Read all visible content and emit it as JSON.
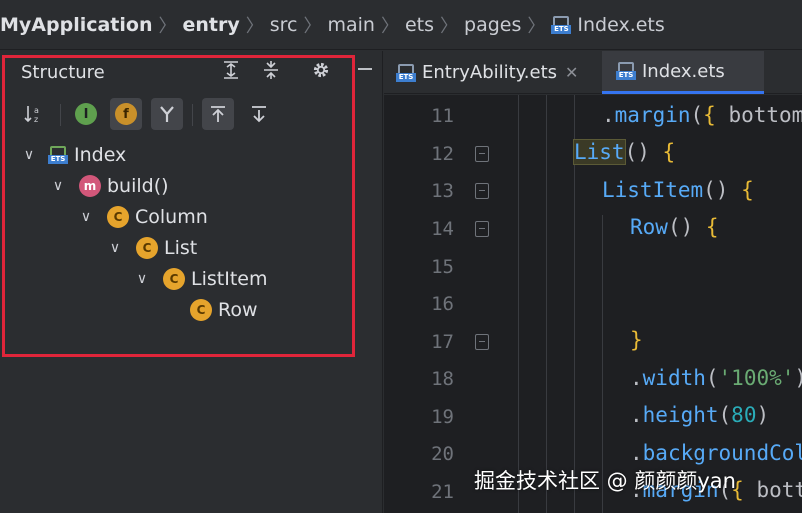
{
  "breadcrumb": {
    "items": [
      "MyApplication",
      "entry",
      "src",
      "main",
      "ets",
      "pages"
    ],
    "file": "Index.ets"
  },
  "structure": {
    "title": "Structure",
    "tree": [
      {
        "label": "Index",
        "kind": "file",
        "depth": 0,
        "expanded": true
      },
      {
        "label": "build()",
        "kind": "method",
        "badge": "m",
        "depth": 1,
        "expanded": true
      },
      {
        "label": "Column",
        "kind": "component",
        "badge": "C",
        "depth": 2,
        "expanded": true
      },
      {
        "label": "List",
        "kind": "component",
        "badge": "C",
        "depth": 3,
        "expanded": true
      },
      {
        "label": "ListItem",
        "kind": "component",
        "badge": "C",
        "depth": 4,
        "expanded": true
      },
      {
        "label": "Row",
        "kind": "component",
        "badge": "C",
        "depth": 5,
        "expanded": false
      }
    ]
  },
  "tabs": [
    {
      "label": "EntryAbility.ets",
      "active": false
    },
    {
      "label": "Index.ets",
      "active": true
    }
  ],
  "editor": {
    "line_numbers": [
      "11",
      "12",
      "13",
      "14",
      "15",
      "16",
      "17",
      "18",
      "19",
      "20",
      "21"
    ]
  },
  "colors": {
    "accent": "#3574f0",
    "highlight_box": "#e0253a",
    "component_icon": "#e6a42c",
    "method_icon": "#d2577a"
  },
  "watermark": "掘金技术社区 @ 颜颜颜yan"
}
